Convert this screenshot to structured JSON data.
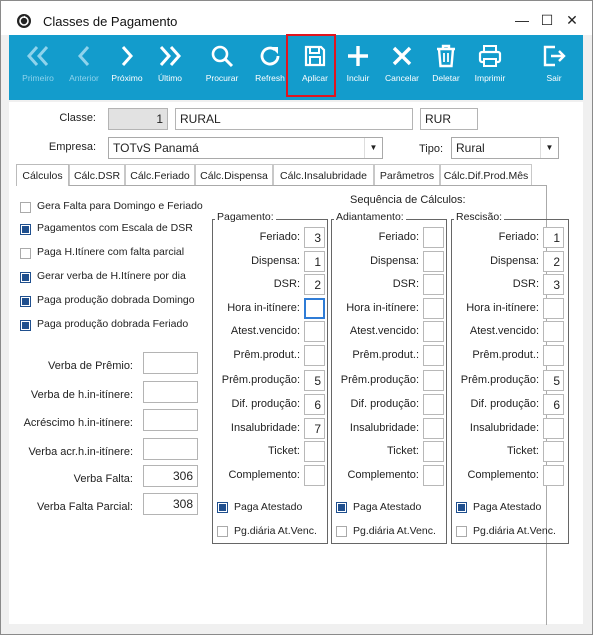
{
  "window": {
    "title": "Classes de Pagamento",
    "controls": {
      "minimize": "—",
      "maximize": "☐",
      "close": "✕"
    }
  },
  "toolbar": [
    {
      "id": "primeiro",
      "label": "Primeiro",
      "icon": "double-chevron-left-icon",
      "enabled": false
    },
    {
      "id": "anterior",
      "label": "Anterior",
      "icon": "chevron-left-icon",
      "enabled": false
    },
    {
      "id": "proximo",
      "label": "Próximo",
      "icon": "chevron-right-icon",
      "enabled": true
    },
    {
      "id": "ultimo",
      "label": "Último",
      "icon": "double-chevron-right-icon",
      "enabled": true
    },
    {
      "id": "procurar",
      "label": "Procurar",
      "icon": "search-icon",
      "enabled": true
    },
    {
      "id": "refresh",
      "label": "Refresh",
      "icon": "refresh-icon",
      "enabled": true
    },
    {
      "id": "aplicar",
      "label": "Aplicar",
      "icon": "save-icon",
      "enabled": true,
      "highlighted": true
    },
    {
      "id": "incluir",
      "label": "Incluir",
      "icon": "plus-icon",
      "enabled": true
    },
    {
      "id": "cancelar",
      "label": "Cancelar",
      "icon": "x-icon",
      "enabled": true
    },
    {
      "id": "deletar",
      "label": "Deletar",
      "icon": "trash-icon",
      "enabled": true
    },
    {
      "id": "imprimir",
      "label": "Imprimir",
      "icon": "printer-icon",
      "enabled": true
    },
    {
      "id": "sair",
      "label": "Sair",
      "icon": "exit-icon",
      "enabled": true
    }
  ],
  "header": {
    "classe_label": "Classe:",
    "classe_code": "1",
    "classe_name": "RURAL",
    "classe_abbr": "RUR",
    "empresa_label": "Empresa:",
    "empresa_value": "TOTvS Panamá",
    "tipo_label": "Tipo:",
    "tipo_value": "Rural"
  },
  "tabs": [
    "Cálculos",
    "Cálc.DSR",
    "Cálc.Feriado",
    "Cálc.Dispensa",
    "Cálc.Insalubridade",
    "Parâmetros",
    "Cálc.Dif.Prod.Mês"
  ],
  "active_tab": "Cálculos",
  "checkboxes": [
    {
      "label": "Gera Falta para Domingo e Feriado",
      "checked": false
    },
    {
      "label": "Pagamentos com Escala de DSR",
      "checked": true
    },
    {
      "label": "Paga H.Itínere com falta parcial",
      "checked": false
    },
    {
      "label": "Gerar verba de H.Itínere por dia",
      "checked": true
    },
    {
      "label": "Paga produção dobrada Domingo",
      "checked": true
    },
    {
      "label": "Paga produção dobrada Feriado",
      "checked": true
    }
  ],
  "verbas": [
    {
      "label": "Verba de Prêmio:",
      "value": ""
    },
    {
      "label": "Verba de h.in-itínere:",
      "value": ""
    },
    {
      "label": "Acréscimo h.in-itínere:",
      "value": ""
    },
    {
      "label": "Verba acr.h.in-itínere:",
      "value": ""
    },
    {
      "label": "Verba Falta:",
      "value": "306"
    },
    {
      "label": "Verba Falta Parcial:",
      "value": "308"
    }
  ],
  "sequencia_title": "Sequência de Cálculos:",
  "row_labels": [
    "Feriado:",
    "Dispensa:",
    "DSR:",
    "Hora in-itínere:",
    "Atest.vencido:",
    "Prêm.produt.:",
    "Prêm.produção:",
    "Dif. produção:",
    "Insalubridade:",
    "Ticket:",
    "Complemento:"
  ],
  "groups": [
    {
      "title": "Pagamento:",
      "values": [
        "3",
        "1",
        "2",
        "",
        "",
        "",
        "5",
        "6",
        "7",
        "",
        ""
      ],
      "paga_atestado": true,
      "pg_diaria": false
    },
    {
      "title": "Adiantamento:",
      "values": [
        "",
        "",
        "",
        "",
        "",
        "",
        "",
        "",
        "",
        "",
        ""
      ],
      "paga_atestado": true,
      "pg_diaria": false
    },
    {
      "title": "Rescisão:",
      "values": [
        "1",
        "2",
        "3",
        "",
        "",
        "",
        "5",
        "6",
        "",
        "",
        ""
      ],
      "paga_atestado": true,
      "pg_diaria": false
    }
  ],
  "group_checks": {
    "paga_atestado": "Paga Atestado",
    "pg_diaria": "Pg.diária At.Venc."
  }
}
